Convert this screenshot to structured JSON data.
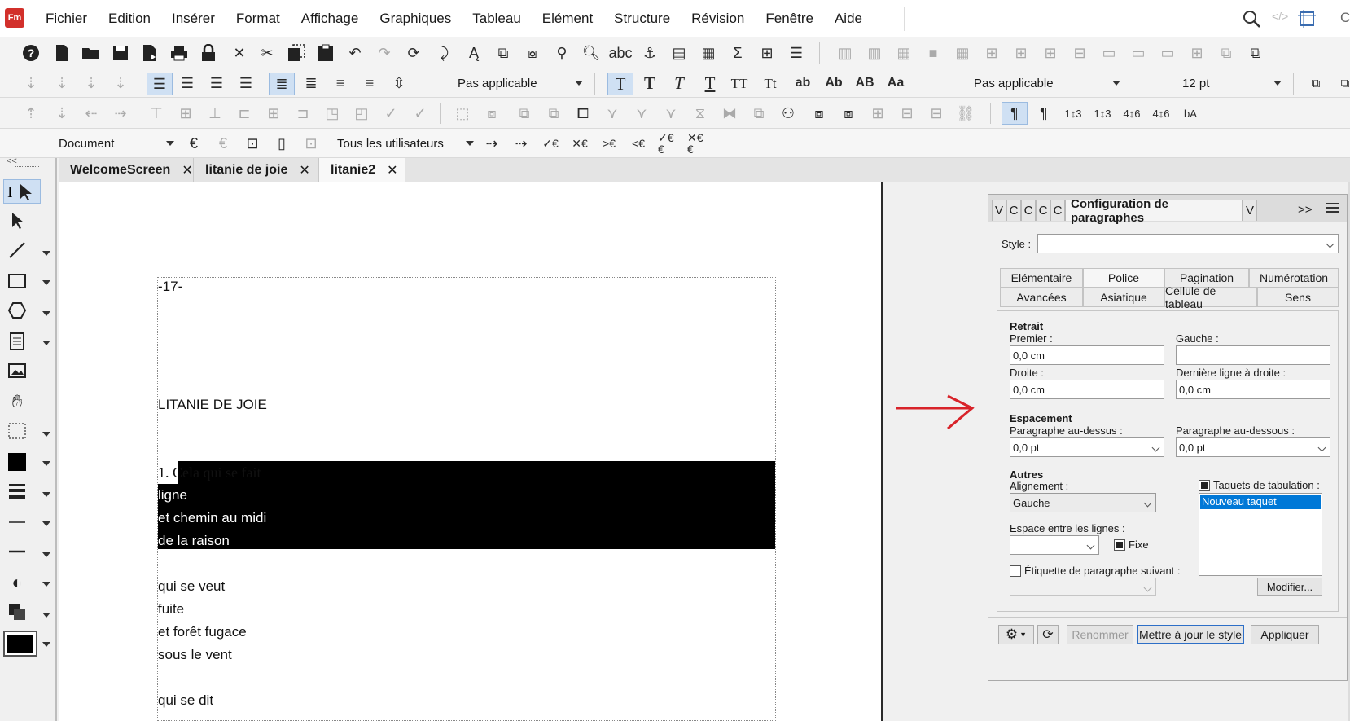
{
  "app": {
    "logo": "Fm"
  },
  "menu": [
    "Fichier",
    "Edition",
    "Insérer",
    "Format",
    "Affichage",
    "Graphiques",
    "Tableau",
    "Elément",
    "Structure",
    "Révision",
    "Fenêtre",
    "Aide"
  ],
  "toolbar": {
    "para_tag_select": "Pas applicable",
    "char_tag_select": "Pas applicable",
    "font_size": "12 pt",
    "text_buttons": [
      "T",
      "T",
      "T",
      "T",
      "TT",
      "Tt",
      "ab",
      "Ab",
      "AB",
      "Aa"
    ]
  },
  "tracking": {
    "view_select": "Document",
    "user_select": "Tous les utilisateurs"
  },
  "tabs": [
    {
      "label": "WelcomeScreen",
      "close": "✕"
    },
    {
      "label": "litanie de joie",
      "close": "✕"
    },
    {
      "label": "litanie2",
      "close": "✕"
    }
  ],
  "document": {
    "page_number": "-17-",
    "title": "LITANIE DE JOIE",
    "stanza1": [
      "1.  Cela qui se fait",
      "ligne",
      "et chemin au midi",
      "de la raison"
    ],
    "stanza2": [
      "qui se veut",
      "fuite",
      "et forêt fugace",
      "sous le vent"
    ],
    "stanza3": [
      "qui se dit"
    ]
  },
  "panel": {
    "tabs_collapsed": [
      "V",
      "C",
      "C",
      "C",
      "C"
    ],
    "title": "Configuration de paragraphes",
    "tab_after": "V",
    "more": ">>",
    "style_label": "Style :",
    "style_value": "",
    "subtabs_row1": [
      "Elémentaire",
      "Police",
      "Pagination",
      "Numérotation"
    ],
    "subtabs_row2": [
      "Avancées",
      "Asiatique",
      "Cellule de tableau",
      "Sens"
    ],
    "retrait": {
      "heading": "Retrait",
      "premier_label": "Premier :",
      "premier_value": "0,0 cm",
      "gauche_label": "Gauche :",
      "gauche_value": "",
      "droite_label": "Droite :",
      "droite_value": "0,0 cm",
      "derniere_label": "Dernière ligne à droite :",
      "derniere_value": "0,0 cm"
    },
    "espacement": {
      "heading": "Espacement",
      "dessus_label": "Paragraphe au-dessus :",
      "dessus_value": "0,0 pt",
      "dessous_label": "Paragraphe au-dessous :",
      "dessous_value": "0,0 pt"
    },
    "autres": {
      "heading": "Autres",
      "alignement_label": "Alignement :",
      "alignement_value": "Gauche",
      "taquets_label": "Taquets de tabulation :",
      "taquet_item": "Nouveau taquet",
      "espace_label": "Espace entre les lignes :",
      "espace_value": "",
      "fixe_label": "Fixe",
      "etiquette_label": "Étiquette de paragraphe suivant :",
      "modifier_label": "Modifier..."
    },
    "buttons": {
      "rename": "Renommer",
      "update": "Mettre à jour le style",
      "apply": "Appliquer"
    }
  },
  "colors": {
    "arrow": "#d8232a",
    "selection": "#0078d7",
    "logo": "#d2302b"
  }
}
